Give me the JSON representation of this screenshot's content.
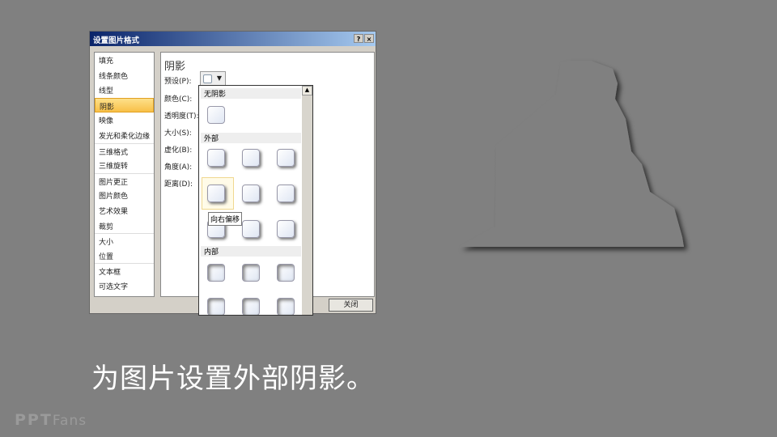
{
  "dialog": {
    "title": "设置图片格式",
    "help_label": "?",
    "close_x": "×",
    "close_button": "关闭",
    "nav": [
      "填充",
      "线条颜色",
      "线型",
      "阴影",
      "映像",
      "发光和柔化边缘",
      "三维格式",
      "三维旋转",
      "图片更正",
      "图片颜色",
      "艺术效果",
      "裁剪",
      "大小",
      "位置",
      "文本框",
      "可选文字"
    ],
    "selected_nav": "阴影",
    "section_title": "阴影",
    "fields": [
      "预设(P):",
      "颜色(C):",
      "透明度(T):",
      "大小(S):",
      "虚化(B):",
      "角度(A):",
      "距离(D):"
    ]
  },
  "dropdown": {
    "groups": [
      "无阴影",
      "外部",
      "内部"
    ],
    "tooltip": "向右偏移",
    "scroll_up": "▲",
    "arrow": "▼"
  },
  "caption": "为图片设置外部阴影。",
  "logo": {
    "ppt": "PPT",
    "fans": "Fans"
  }
}
